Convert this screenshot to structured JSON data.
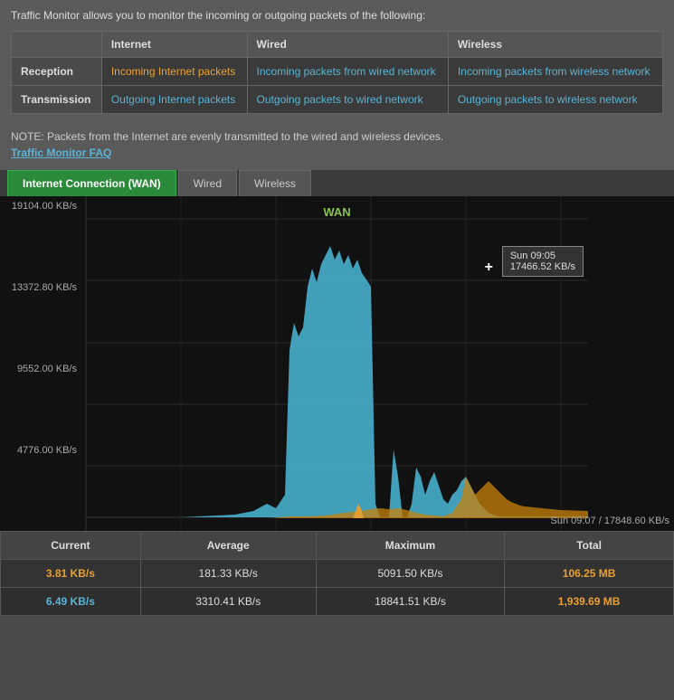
{
  "intro": {
    "text": "Traffic Monitor allows you to monitor the incoming or outgoing packets of the following:"
  },
  "table": {
    "headers": [
      "",
      "Internet",
      "Wired",
      "Wireless"
    ],
    "rows": [
      {
        "label": "Reception",
        "internet": "Incoming Internet packets",
        "wired": "Incoming packets from wired network",
        "wireless": "Incoming packets from wireless network"
      },
      {
        "label": "Transmission",
        "internet": "Outgoing Internet packets",
        "wired": "Outgoing packets to wired network",
        "wireless": "Outgoing packets to wireless network"
      }
    ]
  },
  "note": {
    "text": "NOTE: Packets from the Internet are evenly transmitted to the wired and wireless devices.",
    "faq_link": "Traffic Monitor FAQ"
  },
  "tabs": {
    "items": [
      {
        "label": "Internet Connection (WAN)",
        "active": true
      },
      {
        "label": "Wired",
        "active": false
      },
      {
        "label": "Wireless",
        "active": false
      }
    ]
  },
  "chart": {
    "wan_label": "WAN",
    "y_labels": [
      "19104.00 KB/s",
      "13372.80 KB/s",
      "9552.00 KB/s",
      "4776.00 KB/s",
      ""
    ],
    "tooltip": {
      "time": "Sun 09:05",
      "value": "17466.52 KB/s"
    },
    "bottom_status": "Sun 09:07 / 17848.60 KB/s"
  },
  "stats": {
    "headers": [
      "Current",
      "Average",
      "Maximum",
      "Total"
    ],
    "rows": [
      {
        "current": "3.81 KB/s",
        "average": "181.33 KB/s",
        "maximum": "5091.50 KB/s",
        "total": "106.25 MB",
        "current_color": "orange",
        "total_color": "orange"
      },
      {
        "current": "6.49 KB/s",
        "average": "3310.41 KB/s",
        "maximum": "18841.51 KB/s",
        "total": "1,939.69 MB",
        "current_color": "blue",
        "total_color": "orange"
      }
    ]
  }
}
